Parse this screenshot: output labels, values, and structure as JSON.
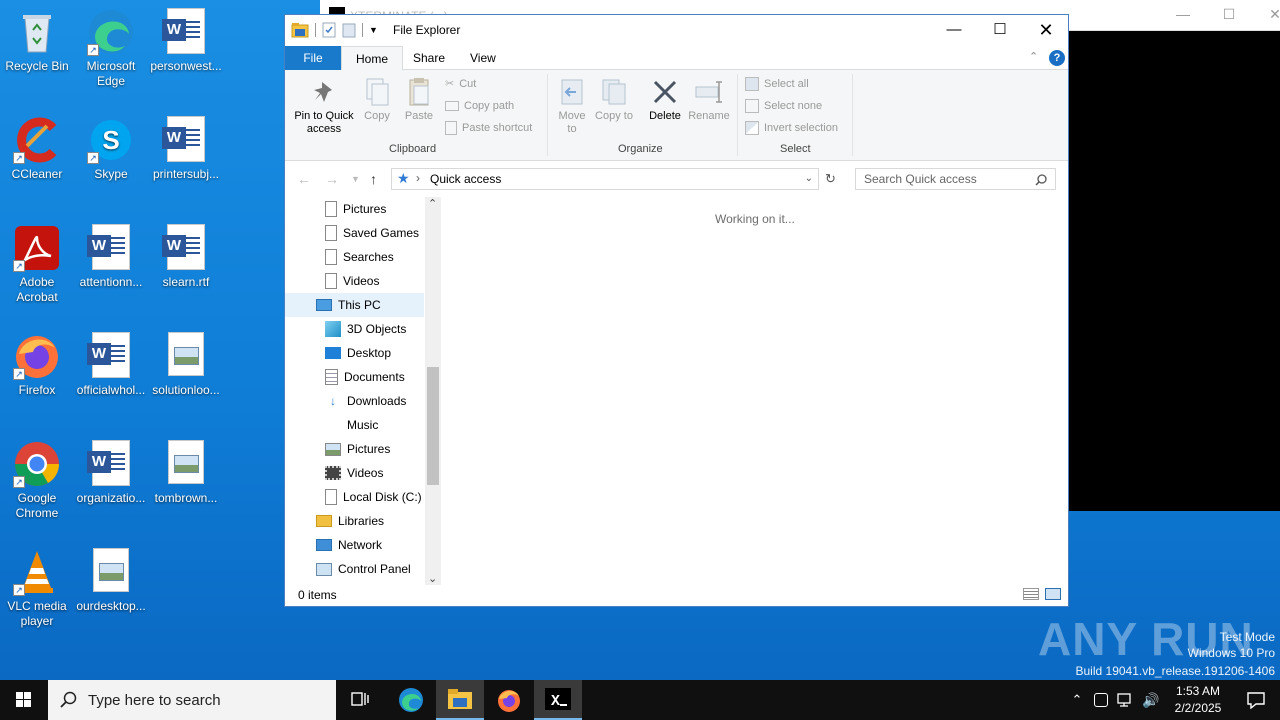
{
  "desktop": {
    "icons": [
      {
        "label": "Recycle Bin"
      },
      {
        "label": "Microsoft Edge"
      },
      {
        "label": "personwest..."
      },
      {
        "label": "CCleaner"
      },
      {
        "label": "Skype"
      },
      {
        "label": "printersubj..."
      },
      {
        "label": "Adobe Acrobat"
      },
      {
        "label": "attentionn..."
      },
      {
        "label": "slearn.rtf"
      },
      {
        "label": "Firefox"
      },
      {
        "label": "officialwhol..."
      },
      {
        "label": "solutionloo..."
      },
      {
        "label": "Google Chrome"
      },
      {
        "label": "organizatio..."
      },
      {
        "label": "tombrown..."
      },
      {
        "label": "VLC media player"
      },
      {
        "label": "ourdesktop..."
      }
    ]
  },
  "background_window": {
    "title": "XTERMINATE (...)",
    "minimize": "—",
    "maximize": "☐",
    "close": "✕"
  },
  "explorer": {
    "title": "File Explorer",
    "window_controls": {
      "minimize": "—",
      "maximize": "☐",
      "close": "✕"
    },
    "tabs": {
      "file": "File",
      "home": "Home",
      "share": "Share",
      "view": "View"
    },
    "ribbon": {
      "pin": "Pin to Quick access",
      "copy": "Copy",
      "paste": "Paste",
      "cut": "Cut",
      "copy_path": "Copy path",
      "paste_shortcut": "Paste shortcut",
      "clipboard_group": "Clipboard",
      "move_to": "Move to",
      "copy_to": "Copy to",
      "delete": "Delete",
      "rename": "Rename",
      "organize_group": "Organize",
      "select_all": "Select all",
      "select_none": "Select none",
      "invert_selection": "Invert selection",
      "select_group": "Select"
    },
    "address": {
      "location": "Quick access"
    },
    "search": {
      "placeholder": "Search Quick access"
    },
    "nav_items": [
      {
        "label": "Pictures"
      },
      {
        "label": "Saved Games"
      },
      {
        "label": "Searches"
      },
      {
        "label": "Videos"
      },
      {
        "label": "This PC"
      },
      {
        "label": "3D Objects"
      },
      {
        "label": "Desktop"
      },
      {
        "label": "Documents"
      },
      {
        "label": "Downloads"
      },
      {
        "label": "Music"
      },
      {
        "label": "Pictures"
      },
      {
        "label": "Videos"
      },
      {
        "label": "Local Disk (C:)"
      },
      {
        "label": "Libraries"
      },
      {
        "label": "Network"
      },
      {
        "label": "Control Panel"
      }
    ],
    "content_message": "Working on it...",
    "status": "0 items"
  },
  "watermark": {
    "brand": "ANY RUN",
    "line1": "Test Mode",
    "line2": "Windows 10 Pro",
    "line3": "Build 19041.vb_release.191206-1406"
  },
  "taskbar": {
    "search_placeholder": "Type here to search",
    "time": "1:53 AM",
    "date": "2/2/2025"
  },
  "colors": {
    "desktop": "#1a8fe3",
    "accent": "#1979ca",
    "taskbar": "#101010"
  }
}
